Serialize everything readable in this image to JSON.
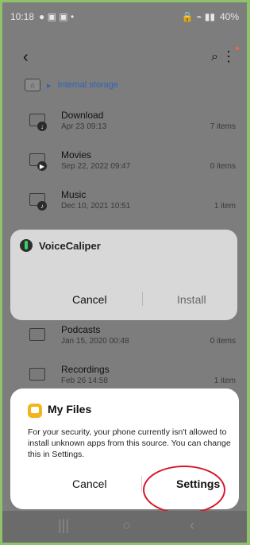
{
  "status_bar": {
    "time": "10:18",
    "battery": "40%"
  },
  "breadcrumb": {
    "label": "Internal storage"
  },
  "folders": [
    {
      "name": "Download",
      "date": "Apr 23 09:13",
      "count": "7 items",
      "badge": "↓"
    },
    {
      "name": "Movies",
      "date": "Sep 22, 2022 09:47",
      "count": "0 items",
      "badge": "▶"
    },
    {
      "name": "Music",
      "date": "Dec 10, 2021 10:51",
      "count": "1 item",
      "badge": "♪"
    },
    {
      "name": "Podcasts",
      "date": "Jan 15, 2020 00:48",
      "count": "0 items",
      "badge": ""
    },
    {
      "name": "Recordings",
      "date": "Feb 26 14:58",
      "count": "1 item",
      "badge": ""
    }
  ],
  "install_dialog": {
    "app_name": "VoiceCaliper",
    "cancel_label": "Cancel",
    "install_label": "Install"
  },
  "bottom_sheet": {
    "title": "My Files",
    "message": "For your security, your phone currently isn't allowed to install unknown apps from this source. You can change this in Settings.",
    "cancel_label": "Cancel",
    "settings_label": "Settings"
  }
}
